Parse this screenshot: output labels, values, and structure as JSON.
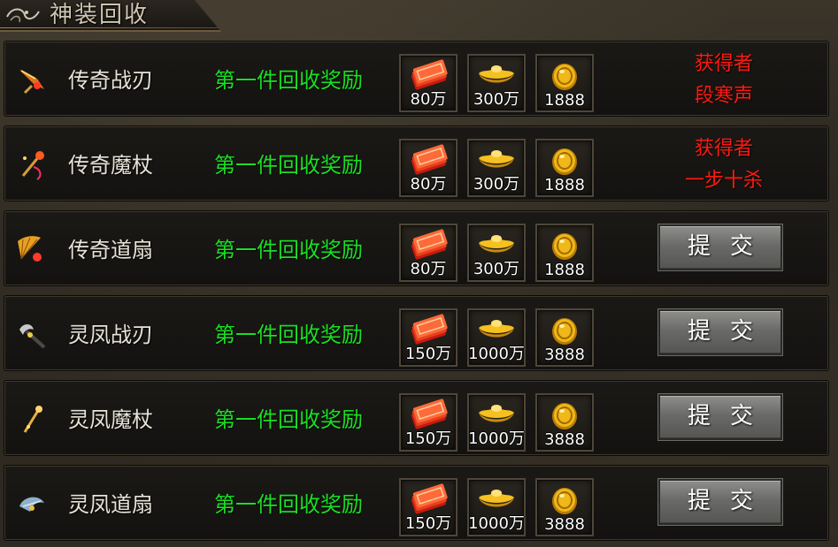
{
  "window": {
    "title": "神装回收"
  },
  "rows": [
    {
      "item": "传奇战刃",
      "icon": "blade-icon",
      "reward_label": "第一件回收奖励",
      "rewards": [
        {
          "icon": "money-stack-icon",
          "label": "80万"
        },
        {
          "icon": "gold-ingot-icon",
          "label": "300万"
        },
        {
          "icon": "gold-coin-icon",
          "label": "1888"
        }
      ],
      "claimed": true,
      "winner_title": "获得者",
      "winner_name": "段寒声"
    },
    {
      "item": "传奇魔杖",
      "icon": "wand-icon",
      "reward_label": "第一件回收奖励",
      "rewards": [
        {
          "icon": "money-stack-icon",
          "label": "80万"
        },
        {
          "icon": "gold-ingot-icon",
          "label": "300万"
        },
        {
          "icon": "gold-coin-icon",
          "label": "1888"
        }
      ],
      "claimed": true,
      "winner_title": "获得者",
      "winner_name": "一步十杀"
    },
    {
      "item": "传奇道扇",
      "icon": "fan-icon",
      "reward_label": "第一件回收奖励",
      "rewards": [
        {
          "icon": "money-stack-icon",
          "label": "80万"
        },
        {
          "icon": "gold-ingot-icon",
          "label": "300万"
        },
        {
          "icon": "gold-coin-icon",
          "label": "1888"
        }
      ],
      "claimed": false,
      "submit_label": "提交"
    },
    {
      "item": "灵凤战刃",
      "icon": "axe-icon",
      "reward_label": "第一件回收奖励",
      "rewards": [
        {
          "icon": "money-stack-icon",
          "label": "150万"
        },
        {
          "icon": "gold-ingot-icon",
          "label": "1000万"
        },
        {
          "icon": "gold-coin-icon",
          "label": "3888"
        }
      ],
      "claimed": false,
      "submit_label": "提交"
    },
    {
      "item": "灵凤魔杖",
      "icon": "staff-icon",
      "reward_label": "第一件回收奖励",
      "rewards": [
        {
          "icon": "money-stack-icon",
          "label": "150万"
        },
        {
          "icon": "gold-ingot-icon",
          "label": "1000万"
        },
        {
          "icon": "gold-coin-icon",
          "label": "3888"
        }
      ],
      "claimed": false,
      "submit_label": "提交"
    },
    {
      "item": "灵凤道扇",
      "icon": "phoenix-fan-icon",
      "reward_label": "第一件回收奖励",
      "rewards": [
        {
          "icon": "money-stack-icon",
          "label": "150万"
        },
        {
          "icon": "gold-ingot-icon",
          "label": "1000万"
        },
        {
          "icon": "gold-coin-icon",
          "label": "3888"
        }
      ],
      "claimed": false,
      "submit_label": "提交"
    }
  ],
  "colors": {
    "reward_label": "#19e023",
    "winner": "#ff1a12",
    "item_name": "#e8e3d8"
  }
}
